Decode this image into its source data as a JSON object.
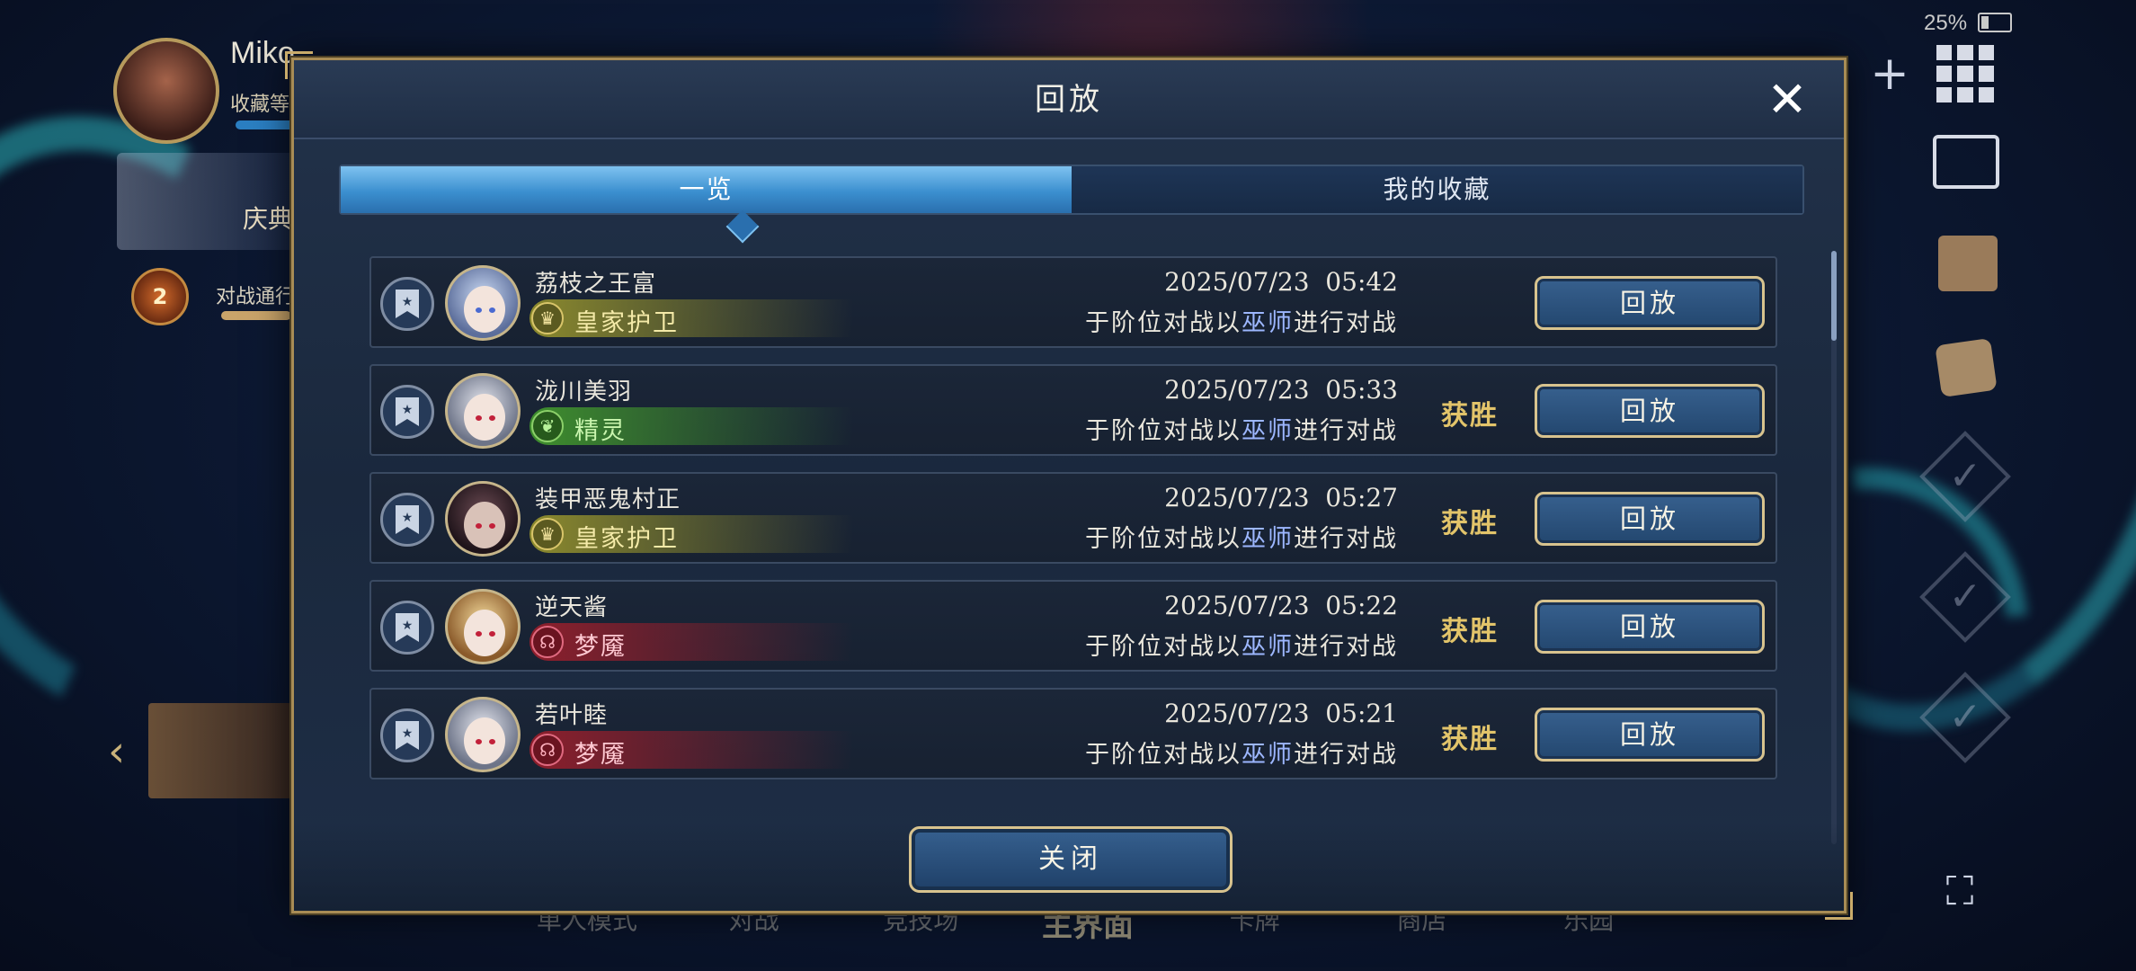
{
  "status": {
    "battery": "25%"
  },
  "profile": {
    "name": "Miko",
    "sub_label": "收藏等",
    "side_card_label": "庆典",
    "season_level": "2",
    "season_label": "对战通行证 第"
  },
  "bottom_nav": [
    "单人模式",
    "对战",
    "竞技场",
    "主界面",
    "卡牌",
    "商店",
    "乐园"
  ],
  "dialog": {
    "title": "回放",
    "tabs": [
      {
        "label": "一览",
        "active": true
      },
      {
        "label": "我的收藏",
        "active": false
      }
    ],
    "close_label": "关闭",
    "rows": [
      {
        "player": "荔枝之王富",
        "class": "皇家护卫",
        "class_icon": "crown-icon",
        "date": "2025/07/23  05:42",
        "desc_prefix": "于阶位对战以",
        "desc_class": "巫师",
        "desc_suffix": "进行对战",
        "result": "",
        "button": "回放"
      },
      {
        "player": "泷川美羽",
        "class": "精灵",
        "class_icon": "leaf-icon",
        "date": "2025/07/23  05:33",
        "desc_prefix": "于阶位对战以",
        "desc_class": "巫师",
        "desc_suffix": "进行对战",
        "result": "获胜",
        "button": "回放"
      },
      {
        "player": "装甲恶鬼村正",
        "class": "皇家护卫",
        "class_icon": "crown-icon",
        "date": "2025/07/23  05:27",
        "desc_prefix": "于阶位对战以",
        "desc_class": "巫师",
        "desc_suffix": "进行对战",
        "result": "获胜",
        "button": "回放"
      },
      {
        "player": "逆天酱",
        "class": "梦魇",
        "class_icon": "nightmare-icon",
        "date": "2025/07/23  05:22",
        "desc_prefix": "于阶位对战以",
        "desc_class": "巫师",
        "desc_suffix": "进行对战",
        "result": "获胜",
        "button": "回放"
      },
      {
        "player": "若叶睦",
        "class": "梦魇",
        "class_icon": "nightmare-icon",
        "date": "2025/07/23  05:21",
        "desc_prefix": "于阶位对战以",
        "desc_class": "巫师",
        "desc_suffix": "进行对战",
        "result": "获胜",
        "button": "回放"
      }
    ]
  },
  "colors": {
    "royal": "#8c8a2e",
    "forest": "#3f8f2e",
    "nightmare": "#8e1f2c",
    "accent_gold": "#d8c38e",
    "win_gold": "#e2c46a",
    "tab_active": "#3b8fcf"
  }
}
